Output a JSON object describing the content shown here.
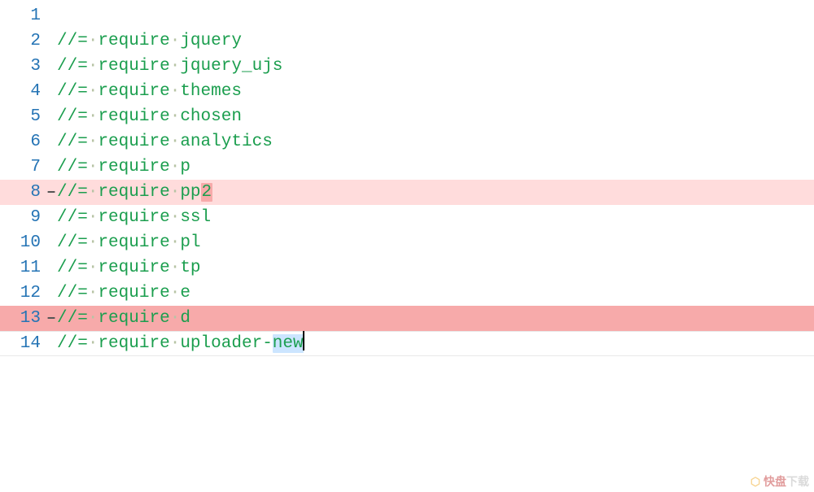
{
  "editor": {
    "whitespace_dot": "·",
    "marker_glyph": "–",
    "lines": [
      {
        "n": 1,
        "text": "",
        "hl": null,
        "marker": false
      },
      {
        "n": 2,
        "text": "//= require jquery",
        "hl": null,
        "marker": false
      },
      {
        "n": 3,
        "text": "//= require jquery_ujs",
        "hl": null,
        "marker": false
      },
      {
        "n": 4,
        "text": "//= require themes",
        "hl": null,
        "marker": false
      },
      {
        "n": 5,
        "text": "//= require chosen",
        "hl": null,
        "marker": false
      },
      {
        "n": 6,
        "text": "//= require analytics",
        "hl": null,
        "marker": false
      },
      {
        "n": 7,
        "text": "//= require p",
        "hl": null,
        "marker": false
      },
      {
        "n": 8,
        "text": "//= require pp2",
        "hl": "light",
        "marker": true,
        "tailbox_last": 1
      },
      {
        "n": 9,
        "text": "//= require ssl",
        "hl": null,
        "marker": false
      },
      {
        "n": 10,
        "text": "//= require pl",
        "hl": null,
        "marker": false
      },
      {
        "n": 11,
        "text": "//= require tp",
        "hl": null,
        "marker": false
      },
      {
        "n": 12,
        "text": "//= require e",
        "hl": null,
        "marker": false
      },
      {
        "n": 13,
        "text": "//= require d",
        "hl": "dark",
        "marker": true
      },
      {
        "n": 14,
        "text": "//= require uploader-new",
        "hl": null,
        "marker": false,
        "current": true,
        "cursor_at_end": true,
        "select_last": 3
      }
    ]
  },
  "watermark": {
    "icon": "⬡",
    "brand": "快盘",
    "suffix": "下载"
  }
}
